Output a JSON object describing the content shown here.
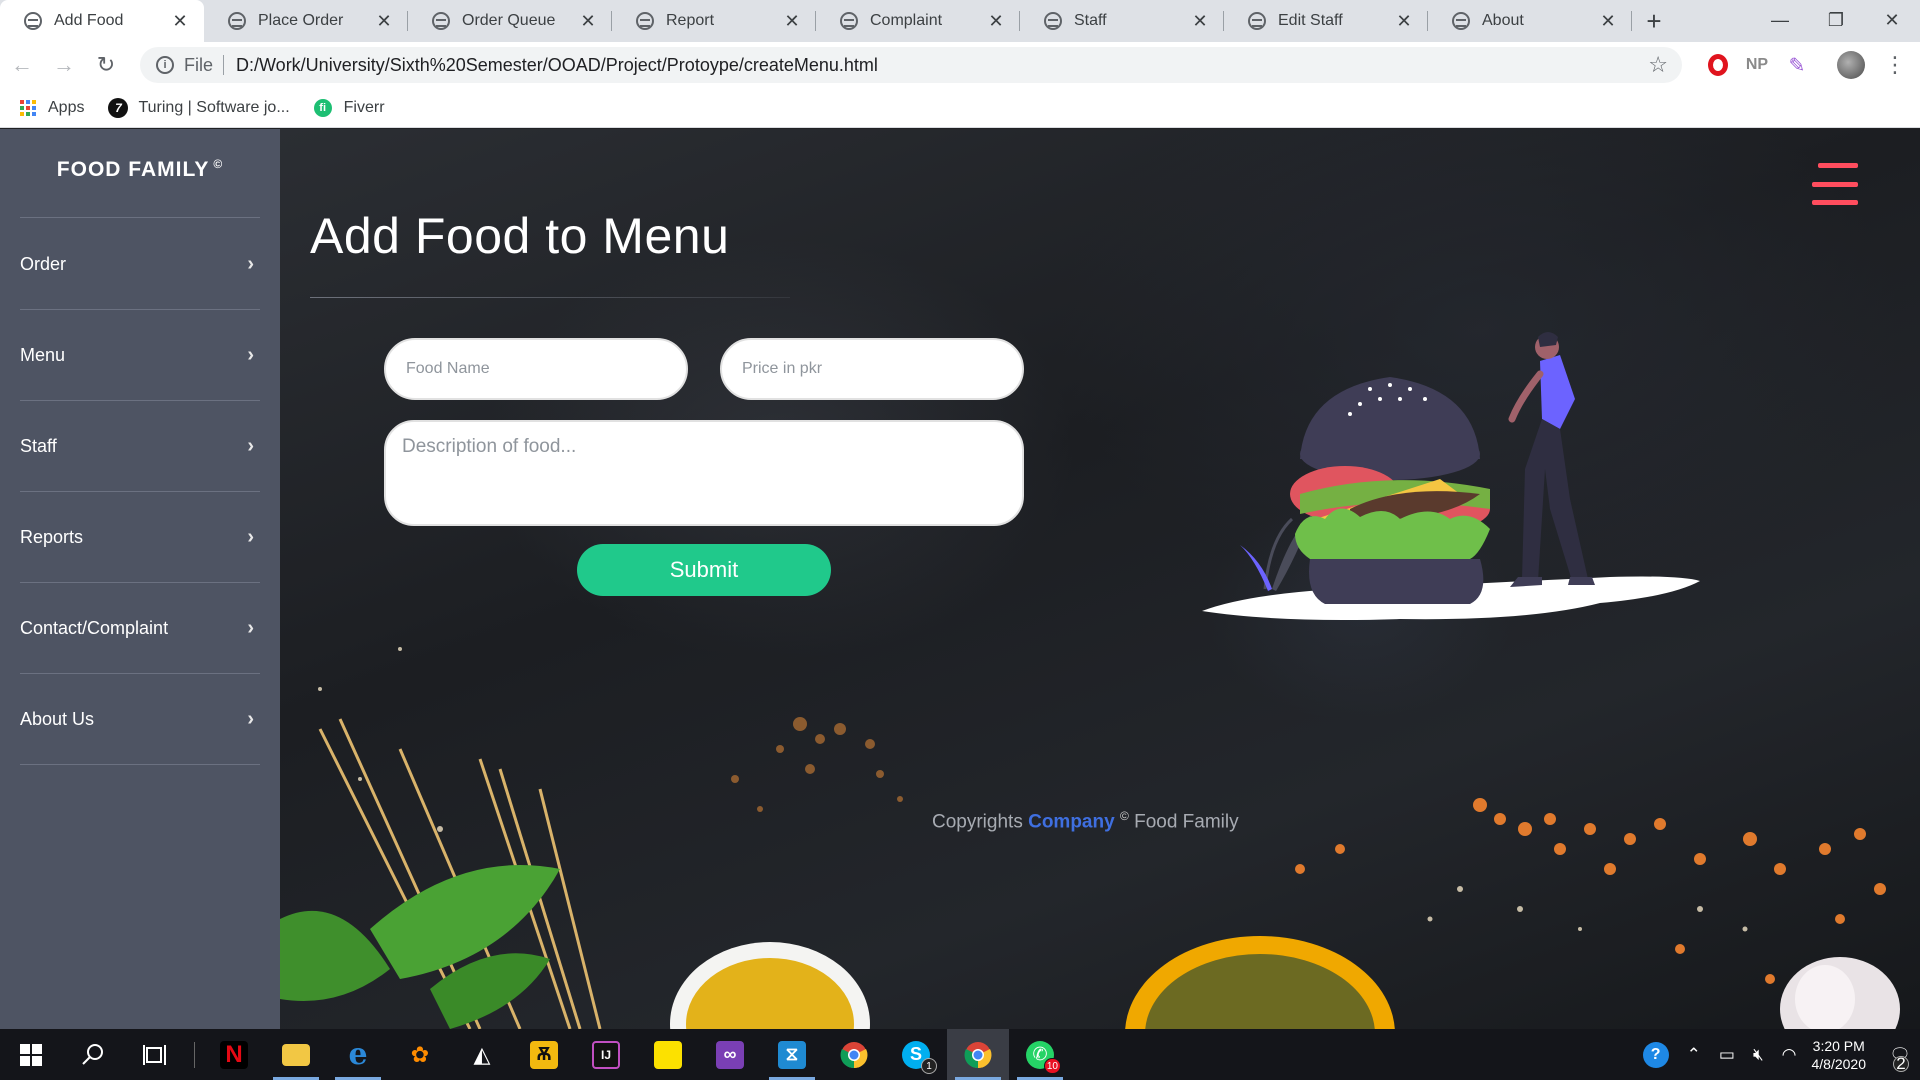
{
  "browser": {
    "tabs": [
      {
        "label": "Add Food",
        "active": true
      },
      {
        "label": "Place Order",
        "active": false
      },
      {
        "label": "Order Queue",
        "active": false
      },
      {
        "label": "Report",
        "active": false
      },
      {
        "label": "Complaint",
        "active": false
      },
      {
        "label": "Staff",
        "active": false
      },
      {
        "label": "Edit Staff",
        "active": false
      },
      {
        "label": "About",
        "active": false
      }
    ],
    "new_tab": "+",
    "window_controls": {
      "minimize": "—",
      "restore": "❐",
      "close": "✕"
    },
    "nav": {
      "back": "←",
      "forward": "→",
      "reload": "↻"
    },
    "address": {
      "scheme": "File",
      "url": "D:/Work/University/Sixth%20Semester/OOAD/Project/Protoype/createMenu.html",
      "star": "☆"
    },
    "extensions": {
      "np": "NP",
      "menu": "⋮"
    },
    "bookmarks": [
      {
        "label": "Apps",
        "icon": "apps-grid-icon"
      },
      {
        "label": "Turing | Software jo...",
        "icon": "turing-icon"
      },
      {
        "label": "Fiverr",
        "icon": "fiverr-icon"
      }
    ]
  },
  "sidebar": {
    "brand": "FOOD FAMILY",
    "brand_mark": "©",
    "items": [
      {
        "label": "Order",
        "chevron": "›"
      },
      {
        "label": "Menu",
        "chevron": "›"
      },
      {
        "label": "Staff",
        "chevron": "›"
      },
      {
        "label": "Reports",
        "chevron": "›"
      },
      {
        "label": "Contact/Complaint",
        "chevron": "›"
      },
      {
        "label": "About Us",
        "chevron": "›"
      }
    ]
  },
  "main": {
    "title": "Add Food to Menu",
    "form": {
      "food_name_placeholder": "Food Name",
      "price_placeholder": "Price in pkr",
      "description_placeholder": "Description of food...",
      "submit_label": "Submit"
    },
    "footer": {
      "prefix": "Copyrights",
      "company": "Company",
      "mark": "©",
      "suffix": "Food Family"
    }
  },
  "taskbar": {
    "apps": [
      {
        "name": "start",
        "running": false
      },
      {
        "name": "search",
        "running": false
      },
      {
        "name": "task-view",
        "running": false
      },
      {
        "name": "netflix",
        "running": false
      },
      {
        "name": "file-explorer",
        "running": true
      },
      {
        "name": "edge",
        "running": true
      },
      {
        "name": "paint-3d",
        "running": false
      },
      {
        "name": "unity",
        "running": false
      },
      {
        "name": "axure",
        "running": false
      },
      {
        "name": "jetbrains",
        "running": false
      },
      {
        "name": "sticky-notes",
        "running": false
      },
      {
        "name": "visual-studio",
        "running": false
      },
      {
        "name": "vscode",
        "running": true
      },
      {
        "name": "chrome",
        "running": false
      },
      {
        "name": "skype",
        "running": false,
        "badge": "1"
      },
      {
        "name": "chrome-active",
        "running": true,
        "active": true
      },
      {
        "name": "whatsapp",
        "running": true,
        "badge": "10"
      }
    ],
    "clock": {
      "time": "3:20 PM",
      "date": "4/8/2020"
    },
    "notifications_count": "2"
  },
  "colors": {
    "sidebar": "#4e5463",
    "accent_green": "#20c98b",
    "hamburger_red": "#ff4d5e",
    "company_blue": "#3f6fe0"
  }
}
